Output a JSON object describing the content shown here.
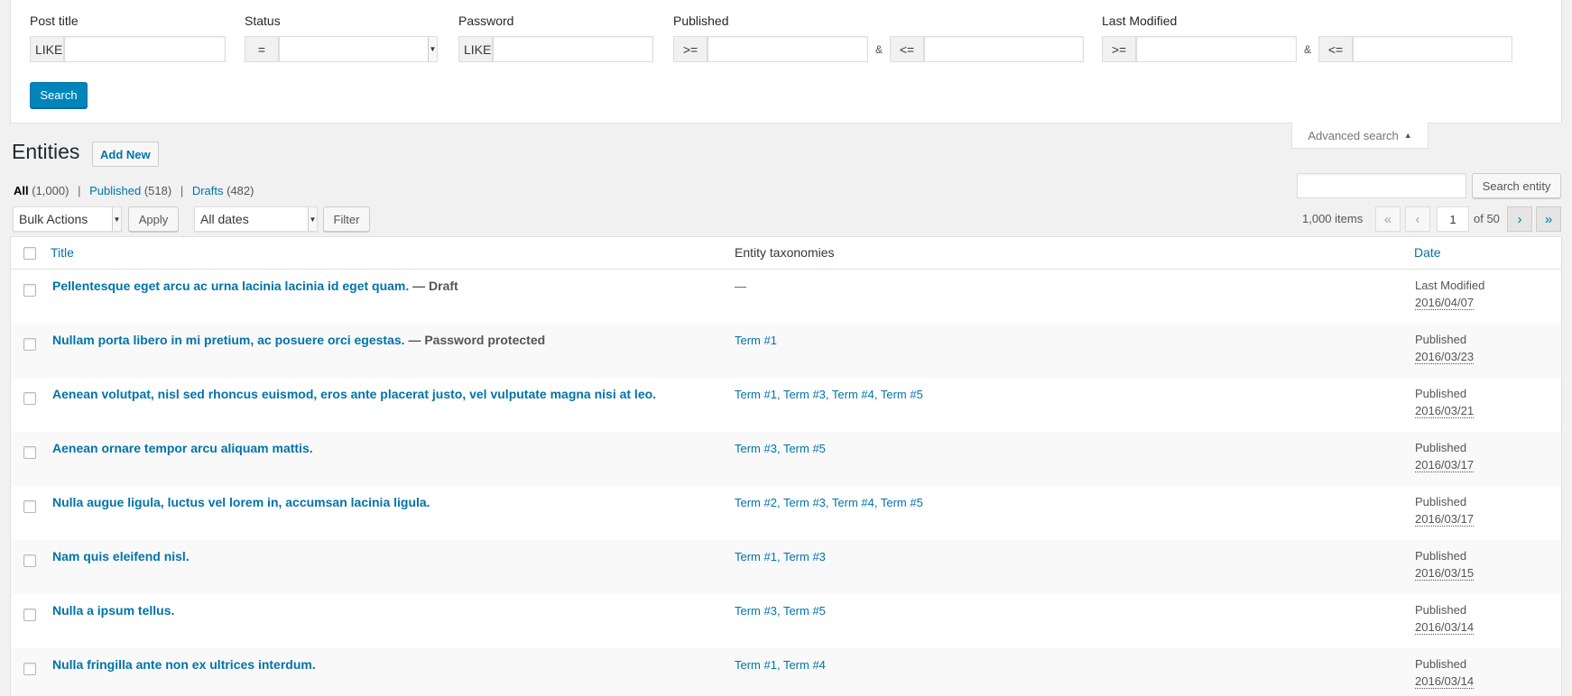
{
  "advanced_search": {
    "post_title": {
      "label": "Post title",
      "operator": "LIKE",
      "value": ""
    },
    "status": {
      "label": "Status",
      "operator": "=",
      "value": ""
    },
    "password": {
      "label": "Password",
      "operator": "LIKE",
      "value": ""
    },
    "published": {
      "label": "Published",
      "op_from": ">=",
      "amp": "&",
      "op_to": "<=",
      "from": "",
      "to": ""
    },
    "last_modified": {
      "label": "Last Modified",
      "op_from": ">=",
      "amp": "&",
      "op_to": "<=",
      "from": "",
      "to": ""
    },
    "search_label": "Search",
    "toggle_label": "Advanced search",
    "toggle_icon": "triangle-up-icon"
  },
  "header": {
    "title": "Entities",
    "add_new_label": "Add New"
  },
  "views": {
    "all": {
      "label": "All",
      "count": "(1,000)"
    },
    "published": {
      "label": "Published",
      "count": "(518)"
    },
    "drafts": {
      "label": "Drafts",
      "count": "(482)"
    },
    "separator": "|"
  },
  "search_box": {
    "value": "",
    "button_label": "Search entity"
  },
  "tablenav": {
    "bulk_actions": "Bulk Actions",
    "apply_label": "Apply",
    "date_filter": "All dates",
    "filter_label": "Filter",
    "items_count": "1,000 items",
    "first": "«",
    "prev": "‹",
    "next": "›",
    "last": "»",
    "current_page": "1",
    "total_pages": "of 50"
  },
  "columns": {
    "title": "Title",
    "taxonomies": "Entity taxonomies",
    "date": "Date"
  },
  "rows": [
    {
      "title": "Pellentesque eget arcu ac urna lacinia lacinia id eget quam.",
      "state": " — Draft",
      "taxonomies": "—",
      "status": "Last Modified",
      "date": "2016/04/07"
    },
    {
      "title": "Nullam porta libero in mi pretium, ac posuere orci egestas.",
      "state": " — Password protected",
      "taxonomies": "Term #1",
      "status": "Published",
      "date": "2016/03/23"
    },
    {
      "title": "Aenean volutpat, nisl sed rhoncus euismod, eros ante placerat justo, vel vulputate magna nisi at leo.",
      "state": "",
      "taxonomies": "Term #1, Term #3, Term #4, Term #5",
      "status": "Published",
      "date": "2016/03/21"
    },
    {
      "title": "Aenean ornare tempor arcu aliquam mattis.",
      "state": "",
      "taxonomies": "Term #3, Term #5",
      "status": "Published",
      "date": "2016/03/17"
    },
    {
      "title": "Nulla augue ligula, luctus vel lorem in, accumsan lacinia ligula.",
      "state": "",
      "taxonomies": "Term #2, Term #3, Term #4, Term #5",
      "status": "Published",
      "date": "2016/03/17"
    },
    {
      "title": "Nam quis eleifend nisl.",
      "state": "",
      "taxonomies": "Term #1, Term #3",
      "status": "Published",
      "date": "2016/03/15"
    },
    {
      "title": "Nulla a ipsum tellus.",
      "state": "",
      "taxonomies": "Term #3, Term #5",
      "status": "Published",
      "date": "2016/03/14"
    },
    {
      "title": "Nulla fringilla ante non ex ultrices interdum.",
      "state": "",
      "taxonomies": "Term #1, Term #4",
      "status": "Published",
      "date": "2016/03/14"
    }
  ],
  "colors": {
    "link": "#0073aa",
    "primary_button": "#0085ba",
    "alt_row": "#f9f9f9",
    "background": "#f1f1f1"
  }
}
